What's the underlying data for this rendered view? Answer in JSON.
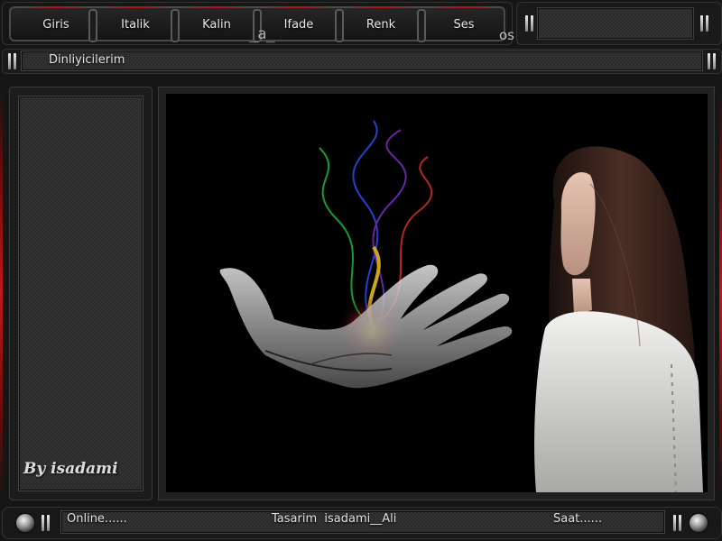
{
  "menu": {
    "items": [
      {
        "label": "Giris"
      },
      {
        "label": "Italik"
      },
      {
        "label": "Kalin"
      },
      {
        "label": "Ifade"
      },
      {
        "label": "Renk"
      },
      {
        "label": "Ses"
      }
    ],
    "deco_a": "_a_",
    "deco_os": "os"
  },
  "listeners": {
    "label": "Dinliyicilerim"
  },
  "left_panel": {
    "signature": "By isadami"
  },
  "status": {
    "online": "Online......",
    "credit": "Tasarim  isadami__Ali",
    "clock": "Saat......"
  },
  "icons": {
    "pause": "pause-icon",
    "knob": "round-knob-icon"
  },
  "colors": {
    "accent_red": "#c01818",
    "panel": "#2b2b2b"
  }
}
